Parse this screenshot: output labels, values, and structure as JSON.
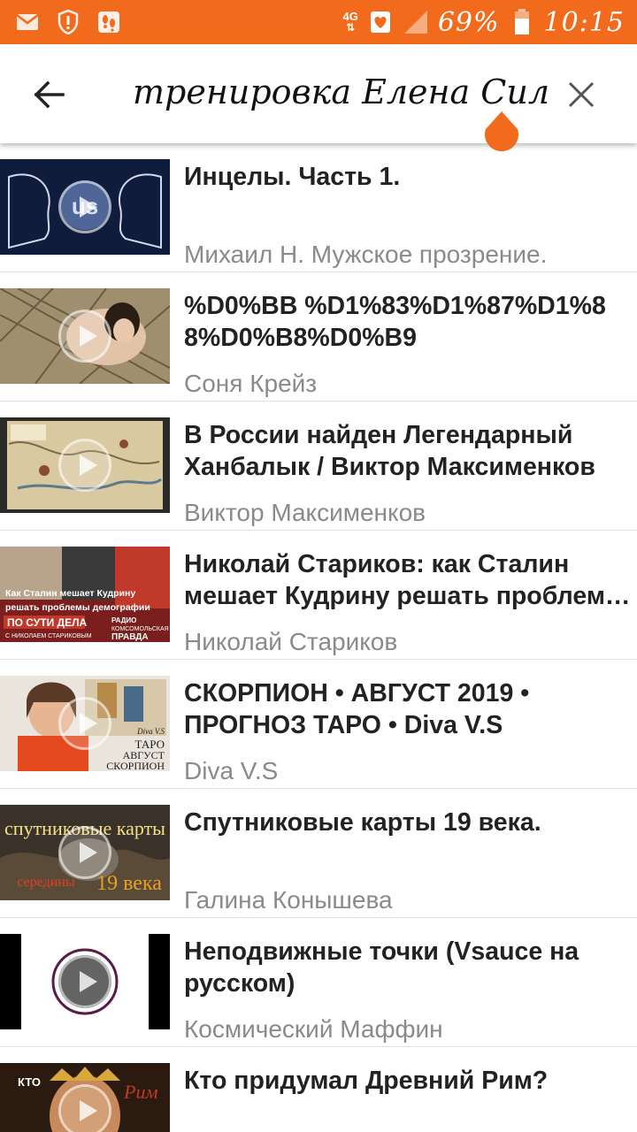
{
  "status_bar": {
    "network": "4G",
    "battery": "69%",
    "time": "10:15",
    "icons": [
      "mail-icon",
      "shield-alert-icon",
      "footprints-icon",
      "heart-icon",
      "signal-icon",
      "battery-icon"
    ]
  },
  "search": {
    "query": "тренировка Елена Силка",
    "back_icon": "arrow-left-icon",
    "clear_icon": "close-icon"
  },
  "colors": {
    "accent": "#f26a1b",
    "title_text": "#222222",
    "channel_text": "#8a8a8a"
  },
  "results": [
    {
      "title": "Инцелы. Часть 1.",
      "channel": "Михаил Н. Мужское прозрение."
    },
    {
      "title": "%D0%BB %D1%83%D1%87%D1%88%D0%B8%D0%B9",
      "channel": "Соня Крейз"
    },
    {
      "title": "В России найден Легендарный Ханбалык / Виктор Максименков",
      "channel": "Виктор Максименков"
    },
    {
      "title": "Николай Стариков: как Сталин мешает Кудрину решать проблемы демографии",
      "channel": "Николай Стариков"
    },
    {
      "title": "СКОРПИОН • АВГУСТ 2019 • ПРОГНОЗ ТАРО • Diva V.S",
      "channel": "Diva V.S"
    },
    {
      "title": "Спутниковые карты 19 века.",
      "channel": "Галина Конышева"
    },
    {
      "title": "Неподвижные точки (Vsauce на русском)",
      "channel": "Космический Маффин"
    },
    {
      "title": "Кто придумал Древний Рим?",
      "channel": ""
    }
  ],
  "thumbnails": {
    "t1_label": "us",
    "t4_caption1": "Как Сталин мешает Кудрину",
    "t4_caption2": "решать проблемы демографии",
    "t4_banner": "ПО СУТИ ДЕЛА",
    "t4_sub": "С НИКОЛАЕМ СТАРИКОВЫМ",
    "t4_logo1": "РАДИО",
    "t4_logo2": "КОМСОМОЛЬСКАЯ",
    "t4_logo3": "ПРАВДА",
    "t5_line1": "ТАРО",
    "t5_line2": "АВГУСТ",
    "t5_line3": "СКОРПИОН",
    "t5_brand": "Diva V.S",
    "t6_line1": "спутниковые карты",
    "t6_line2": "середины",
    "t6_line3": "19 века",
    "t8_label": "КТО",
    "t8_script": "Рим"
  }
}
